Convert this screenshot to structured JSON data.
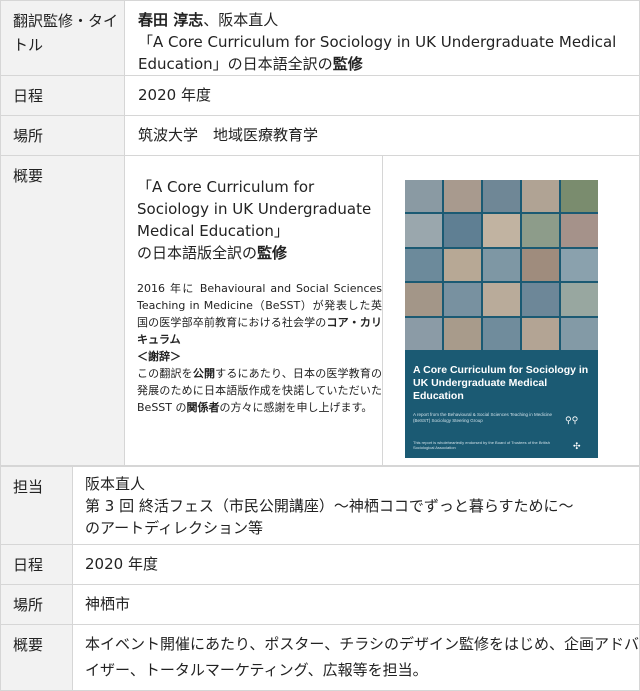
{
  "section1": {
    "row1": {
      "label": "翻訳監修・タイトル",
      "value_bold": "春田 淳志",
      "value_rest": "、阪本直人",
      "value_line2": "「A Core Curriculum for Sociology in UK Undergraduate Medical Education」の日本語全訳の",
      "value_line2_bold": "監修"
    },
    "row2": {
      "label": "日程",
      "value": "2020 年度"
    },
    "row3": {
      "label": "場所",
      "value": "筑波大学　地域医療教育学"
    },
    "row4": {
      "label": "概要",
      "heading": "「A Core Curriculum for Sociology in UK Undergraduate Medical Education」",
      "heading2": "の日本語版全訳の",
      "heading2_bold": "監修",
      "para1": "2016 年に Behavioural and Social Sciences Teaching in Medicine（BeSST）が発表した英国の医学部卒前教育における社会学の",
      "para1_bold": "コア・カリキュラム",
      "para2_bold": "＜謝辞＞",
      "para3": "この翻訳を",
      "para3_bold": "公開",
      "para3b": "するにあたり、日本の医学教育の発展のために日本語版作成を快諾していただいた BeSST の",
      "para3_bold2": "関係者",
      "para3c": "の方々に感謝を申し上げます。"
    },
    "cover": {
      "title": "A Core Curriculum for Sociology in UK Undergraduate Medical Education",
      "subtitle": "A report from the Behavioural & Social Sciences Teaching in Medicine (BeSST) Sociology Steering Group",
      "footer": "This report is wholeheartedly endorsed by the Board of Trustees of the British Sociological Association"
    }
  },
  "section2": {
    "row1": {
      "label": "担当",
      "line1": "阪本直人",
      "line2": "第 3 回 終活フェス（市民公開講座）〜神栖ココでずっと暮らすために〜",
      "line3": "のアートディレクション等"
    },
    "row2": {
      "label": "日程",
      "value": "2020 年度"
    },
    "row3": {
      "label": "場所",
      "value": "神栖市"
    },
    "row4": {
      "label": "概要",
      "value": "本イベント開催にあたり、ポスター、チラシのデザイン監修をはじめ、企画アドバイザー、トータルマーケティング、広報等を担当。"
    }
  },
  "colors": {
    "label_bg": "#f2f2f2",
    "border": "#d6d6d6",
    "cover_bg": "#1b5a73"
  }
}
